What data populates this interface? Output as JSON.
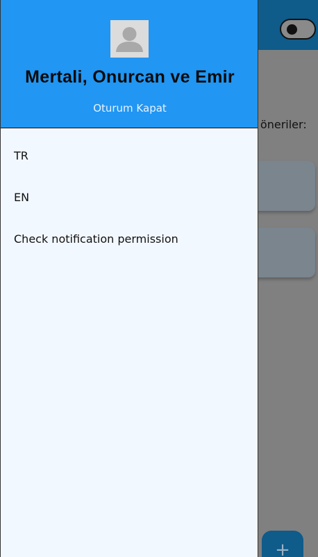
{
  "background_page": {
    "suggestions_label": "e öneriler:",
    "fab_icon": "+"
  },
  "drawer": {
    "user_name": "Mertali, Onurcan ve Emir",
    "logout_label": "Oturum Kapat",
    "items": [
      {
        "label": "TR"
      },
      {
        "label": "EN"
      },
      {
        "label": "Check notification permission"
      }
    ]
  },
  "colors": {
    "drawer_header": "#2196f3",
    "drawer_body": "#f2f8ff",
    "app_bar": "#0f5b8a",
    "scrim": "#7f7f7f"
  }
}
